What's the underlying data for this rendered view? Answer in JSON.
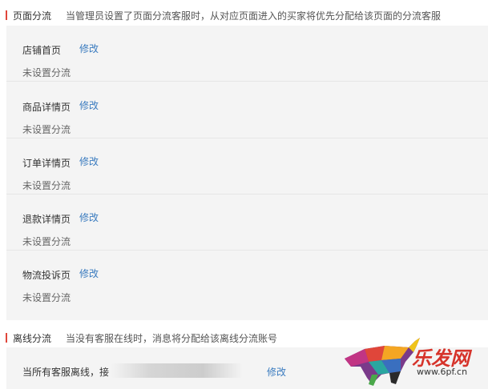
{
  "section1": {
    "title": "页面分流",
    "description": "当管理员设置了页面分流客服时，从对应页面进入的买家将优先分配给该页面的分流客服"
  },
  "pages": [
    {
      "name": "店铺首页",
      "edit_label": "修改",
      "status": "未设置分流"
    },
    {
      "name": "商品详情页",
      "edit_label": "修改",
      "status": "未设置分流"
    },
    {
      "name": "订单详情页",
      "edit_label": "修改",
      "status": "未设置分流"
    },
    {
      "name": "退款详情页",
      "edit_label": "修改",
      "status": "未设置分流"
    },
    {
      "name": "物流投诉页",
      "edit_label": "修改",
      "status": "未设置分流"
    }
  ],
  "section2": {
    "title": "离线分流",
    "description": "当没有客服在线时，消息将分配给该离线分流账号",
    "offline_text": "当所有客服离线，接",
    "edit_label": "修改"
  },
  "watermark": {
    "brand": "乐发网",
    "url": "www.6pf.cn"
  },
  "colors": {
    "accent_bar": "#e0463a",
    "link": "#3a7bbf",
    "panel_bg": "#f4f4f4"
  }
}
